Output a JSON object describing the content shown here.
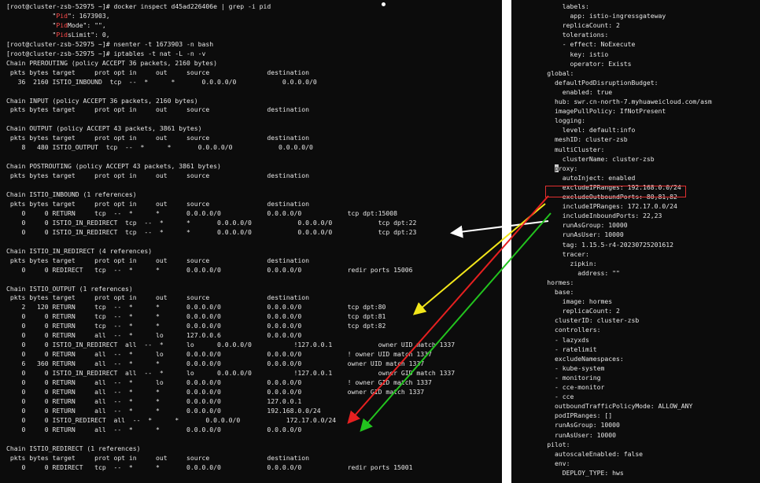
{
  "left_lines": [
    {
      "segments": [
        {
          "t": "[root@cluster-zsb-52975 ~]# docker inspect d45ad226406e | grep -i pid"
        }
      ]
    },
    {
      "segments": [
        {
          "t": "            \""
        },
        {
          "t": "Pid",
          "c": "red"
        },
        {
          "t": "\": 1673903,"
        }
      ]
    },
    {
      "segments": [
        {
          "t": "            \""
        },
        {
          "t": "Pid",
          "c": "red"
        },
        {
          "t": "Mode\": \"\","
        }
      ]
    },
    {
      "segments": [
        {
          "t": "            \""
        },
        {
          "t": "Pid",
          "c": "red"
        },
        {
          "t": "sLimit\": 0,"
        }
      ]
    },
    {
      "segments": [
        {
          "t": "[root@cluster-zsb-52975 ~]# nsenter -t 1673903 -n bash"
        }
      ]
    },
    {
      "segments": [
        {
          "t": "[root@cluster-zsb-52975 ~]# iptables -t nat -L -n -v"
        }
      ]
    },
    {
      "segments": [
        {
          "t": "Chain PREROUTING (policy ACCEPT 36 packets, 2160 bytes)"
        }
      ]
    },
    {
      "segments": [
        {
          "t": " pkts bytes target     prot opt in     out     source               destination"
        }
      ]
    },
    {
      "segments": [
        {
          "t": "   36  2160 ISTIO_INBOUND  tcp  --  *      *       0.0.0.0/0            0.0.0.0/0"
        }
      ]
    },
    {
      "segments": [
        {
          "t": ""
        }
      ]
    },
    {
      "segments": [
        {
          "t": "Chain INPUT (policy ACCEPT 36 packets, 2160 bytes)"
        }
      ]
    },
    {
      "segments": [
        {
          "t": " pkts bytes target     prot opt in     out     source               destination"
        }
      ]
    },
    {
      "segments": [
        {
          "t": ""
        }
      ]
    },
    {
      "segments": [
        {
          "t": "Chain OUTPUT (policy ACCEPT 43 packets, 3861 bytes)"
        }
      ]
    },
    {
      "segments": [
        {
          "t": " pkts bytes target     prot opt in     out     source               destination"
        }
      ]
    },
    {
      "segments": [
        {
          "t": "    8   480 ISTIO_OUTPUT  tcp  --  *      *       0.0.0.0/0            0.0.0.0/0"
        }
      ]
    },
    {
      "segments": [
        {
          "t": ""
        }
      ]
    },
    {
      "segments": [
        {
          "t": "Chain POSTROUTING (policy ACCEPT 43 packets, 3861 bytes)"
        }
      ]
    },
    {
      "segments": [
        {
          "t": " pkts bytes target     prot opt in     out     source               destination"
        }
      ]
    },
    {
      "segments": [
        {
          "t": ""
        }
      ]
    },
    {
      "segments": [
        {
          "t": "Chain ISTIO_INBOUND (1 references)"
        }
      ]
    },
    {
      "segments": [
        {
          "t": " pkts bytes target     prot opt in     out     source               destination"
        }
      ]
    },
    {
      "segments": [
        {
          "t": "    0     0 RETURN     tcp  --  *      *       0.0.0.0/0            0.0.0.0/0            tcp dpt:15008"
        }
      ]
    },
    {
      "segments": [
        {
          "t": "    0     0 ISTIO_IN_REDIRECT  tcp  --  *      *       0.0.0.0/0            0.0.0.0/0            tcp dpt:22"
        }
      ]
    },
    {
      "segments": [
        {
          "t": "    0     0 ISTIO_IN_REDIRECT  tcp  --  *      *       0.0.0.0/0            0.0.0.0/0            tcp dpt:23"
        }
      ]
    },
    {
      "segments": [
        {
          "t": ""
        }
      ]
    },
    {
      "segments": [
        {
          "t": "Chain ISTIO_IN_REDIRECT (4 references)"
        }
      ]
    },
    {
      "segments": [
        {
          "t": " pkts bytes target     prot opt in     out     source               destination"
        }
      ]
    },
    {
      "segments": [
        {
          "t": "    0     0 REDIRECT   tcp  --  *      *       0.0.0.0/0            0.0.0.0/0            redir ports 15006"
        }
      ]
    },
    {
      "segments": [
        {
          "t": ""
        }
      ]
    },
    {
      "segments": [
        {
          "t": "Chain ISTIO_OUTPUT (1 references)"
        }
      ]
    },
    {
      "segments": [
        {
          "t": " pkts bytes target     prot opt in     out     source               destination"
        }
      ]
    },
    {
      "segments": [
        {
          "t": "    2   120 RETURN     tcp  --  *      *       0.0.0.0/0            0.0.0.0/0            tcp dpt:80"
        }
      ]
    },
    {
      "segments": [
        {
          "t": "    0     0 RETURN     tcp  --  *      *       0.0.0.0/0            0.0.0.0/0            tcp dpt:81"
        }
      ]
    },
    {
      "segments": [
        {
          "t": "    0     0 RETURN     tcp  --  *      *       0.0.0.0/0            0.0.0.0/0            tcp dpt:82"
        }
      ]
    },
    {
      "segments": [
        {
          "t": "    0     0 RETURN     all  --  *      lo      127.0.0.6            0.0.0.0/0"
        }
      ]
    },
    {
      "segments": [
        {
          "t": "    0     0 ISTIO_IN_REDIRECT  all  --  *      lo      0.0.0.0/0           !127.0.0.1            owner UID match 1337"
        }
      ]
    },
    {
      "segments": [
        {
          "t": "    0     0 RETURN     all  --  *      lo      0.0.0.0/0            0.0.0.0/0            ! owner UID match 1337"
        }
      ]
    },
    {
      "segments": [
        {
          "t": "    6   360 RETURN     all  --  *      *       0.0.0.0/0            0.0.0.0/0            owner UID match 1337"
        }
      ]
    },
    {
      "segments": [
        {
          "t": "    0     0 ISTIO_IN_REDIRECT  all  --  *      lo      0.0.0.0/0           !127.0.0.1            owner GID match 1337"
        }
      ]
    },
    {
      "segments": [
        {
          "t": "    0     0 RETURN     all  --  *      lo      0.0.0.0/0            0.0.0.0/0            ! owner GID match 1337"
        }
      ]
    },
    {
      "segments": [
        {
          "t": "    0     0 RETURN     all  --  *      *       0.0.0.0/0            0.0.0.0/0            owner GID match 1337"
        }
      ]
    },
    {
      "segments": [
        {
          "t": "    0     0 RETURN     all  --  *      *       0.0.0.0/0            127.0.0.1"
        }
      ]
    },
    {
      "segments": [
        {
          "t": "    0     0 RETURN     all  --  *      *       0.0.0.0/0            192.168.0.0/24"
        }
      ]
    },
    {
      "segments": [
        {
          "t": "    0     0 ISTIO_REDIRECT  all  --  *      *       0.0.0.0/0            172.17.0.0/24"
        }
      ]
    },
    {
      "segments": [
        {
          "t": "    0     0 RETURN     all  --  *      *       0.0.0.0/0            0.0.0.0/0"
        }
      ]
    },
    {
      "segments": [
        {
          "t": ""
        }
      ]
    },
    {
      "segments": [
        {
          "t": "Chain ISTIO_REDIRECT (1 references)"
        }
      ]
    },
    {
      "segments": [
        {
          "t": " pkts bytes target     prot opt in     out     source               destination"
        }
      ]
    },
    {
      "segments": [
        {
          "t": "    0     0 REDIRECT   tcp  --  *      *       0.0.0.0/0            0.0.0.0/0            redir ports 15001"
        }
      ]
    }
  ],
  "right_lines": [
    {
      "segments": [
        {
          "t": "          labels:"
        }
      ]
    },
    {
      "segments": [
        {
          "t": "            app: istio-ingressgateway"
        }
      ]
    },
    {
      "segments": [
        {
          "t": "          replicaCount: 2"
        }
      ]
    },
    {
      "segments": [
        {
          "t": "          tolerations:"
        }
      ]
    },
    {
      "segments": [
        {
          "t": "          - effect: NoExecute"
        }
      ]
    },
    {
      "segments": [
        {
          "t": "            key: istio"
        }
      ]
    },
    {
      "segments": [
        {
          "t": "            operator: Exists"
        }
      ]
    },
    {
      "segments": [
        {
          "t": "      global:"
        }
      ]
    },
    {
      "segments": [
        {
          "t": "        defaultPodDisruptionBudget:"
        }
      ]
    },
    {
      "segments": [
        {
          "t": "          enabled: true"
        }
      ]
    },
    {
      "segments": [
        {
          "t": "        hub: swr.cn-north-7.myhuaweicloud.com/asm"
        }
      ]
    },
    {
      "segments": [
        {
          "t": "        imagePullPolicy: IfNotPresent"
        }
      ]
    },
    {
      "segments": [
        {
          "t": "        logging:"
        }
      ]
    },
    {
      "segments": [
        {
          "t": "          level: default:info"
        }
      ]
    },
    {
      "segments": [
        {
          "t": "        meshID: cluster-zsb"
        }
      ]
    },
    {
      "segments": [
        {
          "t": "        multiCluster:"
        }
      ]
    },
    {
      "segments": [
        {
          "t": "          clusterName: cluster-zsb"
        }
      ]
    },
    {
      "segments": [
        {
          "t": "        "
        },
        {
          "t": "p",
          "c": "cursor"
        },
        {
          "t": "roxy:"
        }
      ]
    },
    {
      "segments": [
        {
          "t": "          autoInject: enabled"
        }
      ]
    },
    {
      "segments": [
        {
          "t": "          excludeIPRanges: 192.168.0.0/24"
        }
      ]
    },
    {
      "segments": [
        {
          "t": "          excludeOutboundPorts: 80,81,82"
        }
      ]
    },
    {
      "segments": [
        {
          "t": "          includeIPRanges: 172.17.0.0/24"
        }
      ]
    },
    {
      "segments": [
        {
          "t": "          includeInboundPorts: 22,23"
        }
      ]
    },
    {
      "segments": [
        {
          "t": "          runAsGroup: 10000"
        }
      ]
    },
    {
      "segments": [
        {
          "t": "          runAsUser: 10000"
        }
      ]
    },
    {
      "segments": [
        {
          "t": "          tag: 1.15.5-r4-20230725201612"
        }
      ]
    },
    {
      "segments": [
        {
          "t": "          tracer:"
        }
      ]
    },
    {
      "segments": [
        {
          "t": "            zipkin:"
        }
      ]
    },
    {
      "segments": [
        {
          "t": "              address: \"\""
        }
      ]
    },
    {
      "segments": [
        {
          "t": "      hormes:"
        }
      ]
    },
    {
      "segments": [
        {
          "t": "        base:"
        }
      ]
    },
    {
      "segments": [
        {
          "t": "          image: hormes"
        }
      ]
    },
    {
      "segments": [
        {
          "t": "          replicaCount: 2"
        }
      ]
    },
    {
      "segments": [
        {
          "t": "        clusterID: cluster-zsb"
        }
      ]
    },
    {
      "segments": [
        {
          "t": "        controllers:"
        }
      ]
    },
    {
      "segments": [
        {
          "t": "        - lazyxds"
        }
      ]
    },
    {
      "segments": [
        {
          "t": "        - ratelimit"
        }
      ]
    },
    {
      "segments": [
        {
          "t": "        excludeNamespaces:"
        }
      ]
    },
    {
      "segments": [
        {
          "t": "        - kube-system"
        }
      ]
    },
    {
      "segments": [
        {
          "t": "        - monitoring"
        }
      ]
    },
    {
      "segments": [
        {
          "t": "        - cce-monitor"
        }
      ]
    },
    {
      "segments": [
        {
          "t": "        - cce"
        }
      ]
    },
    {
      "segments": [
        {
          "t": "        outboundTrafficPolicyMode: ALLOW_ANY"
        }
      ]
    },
    {
      "segments": [
        {
          "t": "        podIPRanges: []"
        }
      ]
    },
    {
      "segments": [
        {
          "t": "        runAsGroup: 10000"
        }
      ]
    },
    {
      "segments": [
        {
          "t": "        runAsUser: 10000"
        }
      ]
    },
    {
      "segments": [
        {
          "t": "      pilot:"
        }
      ]
    },
    {
      "segments": [
        {
          "t": "        autoscaleEnabled: false"
        }
      ]
    },
    {
      "segments": [
        {
          "t": "        env:"
        }
      ]
    },
    {
      "segments": [
        {
          "t": "          DEPLOY_TYPE: hws"
        }
      ]
    }
  ],
  "colors": {
    "terminal_bg": "#0c0c0c",
    "text": "#e6e6e6",
    "pid_highlight": "#ff4b4b",
    "box": "#e23030",
    "arrow_white": "#ffffff",
    "arrow_yellow": "#f2e61a",
    "arrow_red": "#e62020",
    "arrow_green": "#22c41e"
  },
  "annotations": {
    "highlight_box_target": "excludeIPRanges: 192.168.0.0/24",
    "arrows": [
      {
        "color": "white",
        "from": "includeInboundPorts: 22,23",
        "to": "tcp dpt:22"
      },
      {
        "color": "yellow",
        "from": "excludeOutboundPorts: 80,81,82",
        "to": "tcp dpt:80"
      },
      {
        "color": "red",
        "from": "excludeIPRanges: 192.168.0.0/24",
        "to": "192.168.0.0/24"
      },
      {
        "color": "green",
        "from": "includeIPRanges: 172.17.0.0/24",
        "to": "172.17.0.0/24"
      }
    ]
  }
}
